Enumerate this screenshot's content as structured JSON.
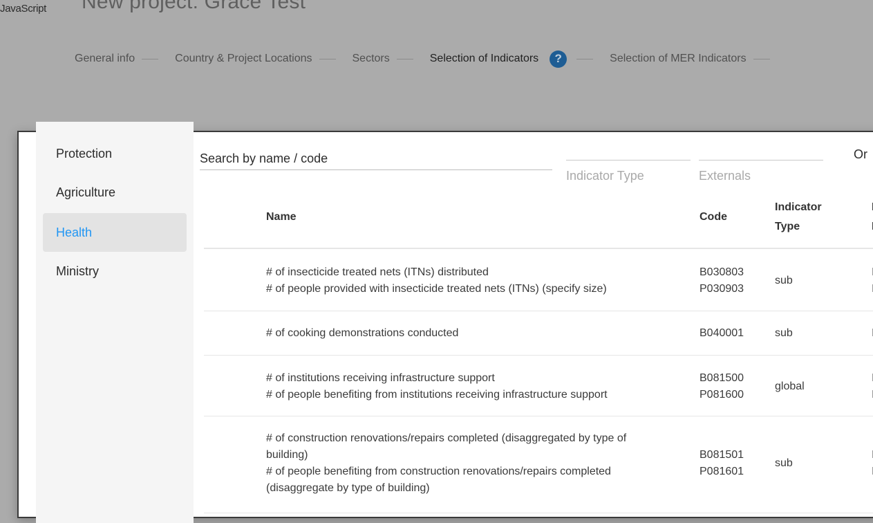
{
  "page": {
    "title": "New project: Grace Test",
    "noscript_text": "JavaScript"
  },
  "stepper": {
    "steps": [
      {
        "label": "General info"
      },
      {
        "label": "Country & Project Locations"
      },
      {
        "label": "Sectors"
      },
      {
        "label": "Selection of Indicators",
        "active": true
      },
      {
        "label": "Selection of MER Indicators"
      }
    ],
    "help_icon": "?"
  },
  "modal": {
    "sidebar": {
      "items": [
        {
          "label": "Protection"
        },
        {
          "label": "Agriculture"
        },
        {
          "label": "Health",
          "selected": true
        },
        {
          "label": "Ministry"
        }
      ]
    },
    "search": {
      "placeholder": "Search by name / code",
      "value": ""
    },
    "filters": {
      "indicator_type": "Indicator Type",
      "externals": "Externals"
    },
    "org_header_partial": "Or",
    "table": {
      "headers": {
        "name": "Name",
        "code": "Code",
        "indicator_type_1": "Indicator",
        "indicator_type_2": "Type",
        "extra_1": "I",
        "extra_2": "I"
      },
      "rows": [
        {
          "names": [
            "# of insecticide treated nets (ITNs) distributed",
            "# of people provided with insecticide treated nets (ITNs) (specify size)"
          ],
          "codes": [
            "B030803",
            "P030903"
          ],
          "type": "sub",
          "extra": [
            "I",
            "I"
          ]
        },
        {
          "names": [
            "# of cooking demonstrations conducted"
          ],
          "codes": [
            "B040001"
          ],
          "type": "sub",
          "extra": [
            "I"
          ]
        },
        {
          "names": [
            "# of institutions receiving infrastructure support",
            "# of people benefiting from institutions receiving infrastructure support"
          ],
          "codes": [
            "B081500",
            "P081600"
          ],
          "type": "global",
          "extra": [
            "I",
            "I"
          ]
        },
        {
          "names": [
            "# of construction renovations/repairs completed (disaggregated by type of",
            "building)",
            "# of people benefiting from construction renovations/repairs completed",
            "(disaggregate by type of building)"
          ],
          "codes": [
            "B081501",
            "P081601"
          ],
          "type": "sub",
          "extra": [
            "I",
            "I"
          ]
        }
      ]
    }
  },
  "colors": {
    "overlay": "#ababab",
    "accent": "#2196f3",
    "help_icon_bg": "#1e5d94",
    "selected_bg": "#e3e3e3"
  }
}
